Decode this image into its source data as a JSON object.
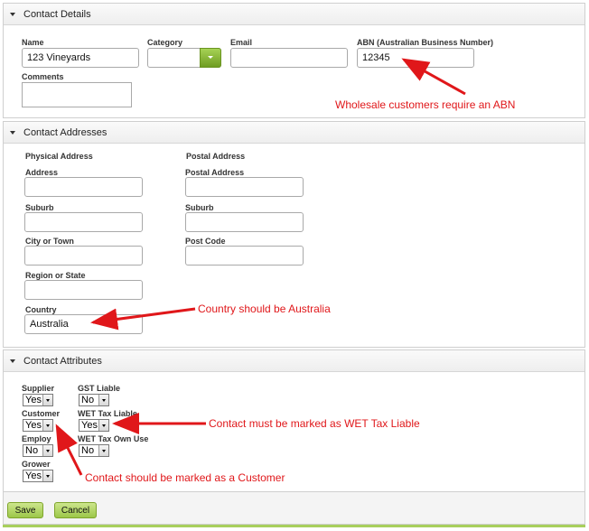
{
  "contact_details": {
    "title": "Contact Details",
    "name_label": "Name",
    "name_value": "123 Vineyards",
    "category_label": "Category",
    "email_label": "Email",
    "abn_label": "ABN (Australian Business Number)",
    "abn_value": "12345",
    "comments_label": "Comments"
  },
  "contact_addresses": {
    "title": "Contact Addresses",
    "physical_heading": "Physical Address",
    "postal_heading": "Postal Address",
    "address_label": "Address",
    "postal_address_label": "Postal Address",
    "suburb_label": "Suburb",
    "postal_suburb_label": "Suburb",
    "city_label": "City or Town",
    "post_code_label": "Post Code",
    "region_label": "Region or State",
    "country_label": "Country",
    "country_value": "Australia"
  },
  "contact_attributes": {
    "title": "Contact Attributes",
    "supplier_label": "Supplier",
    "supplier_value": "Yes",
    "gst_label": "GST Liable",
    "gst_value": "No",
    "customer_label": "Customer",
    "customer_value": "Yes",
    "wet_label": "WET Tax Liable",
    "wet_value": "Yes",
    "employee_label": "Employ",
    "employee_value": "No",
    "wet_own_label": "WET Tax Own Use",
    "wet_own_value": "No",
    "grower_label": "Grower",
    "grower_value": "Yes"
  },
  "footer": {
    "save_label": "Save",
    "cancel_label": "Cancel"
  },
  "annotations": {
    "abn": "Wholesale customers require an ABN",
    "country": "Country should be Australia",
    "wet": "Contact must be marked as WET Tax Liable",
    "customer": "Contact should be marked as a Customer"
  },
  "colors": {
    "annotation": "#e0171a",
    "button_green": "#9cc749"
  }
}
